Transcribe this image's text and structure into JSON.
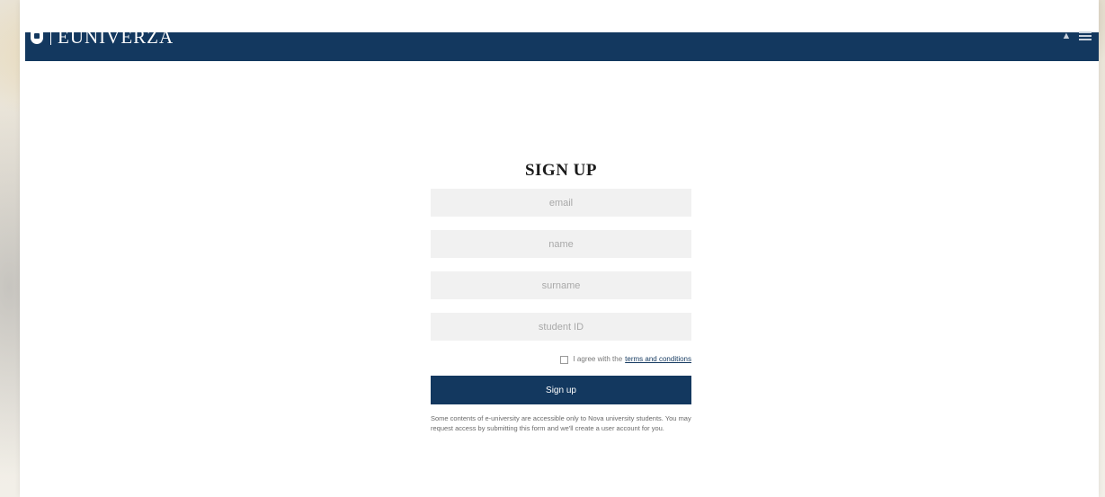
{
  "header": {
    "brand": "EUNIVERZA"
  },
  "signup": {
    "title": "SIGN UP",
    "fields": {
      "email_placeholder": "email",
      "name_placeholder": "name",
      "surname_placeholder": "surname",
      "student_id_placeholder": "student ID"
    },
    "agree_text": "I agree with the",
    "terms_link": "terms and conditions",
    "submit_label": "Sign up",
    "note": "Some contents of e-university are accessible only to Nova university students. You may request access by submitting this form and we'll create a user account for you."
  },
  "colors": {
    "primary": "#13385f",
    "field_bg": "#f1f1f1"
  },
  "icons": {
    "logo": "shield-logo-icon",
    "account": "graduation-cap-icon",
    "menu": "hamburger-menu-icon"
  }
}
